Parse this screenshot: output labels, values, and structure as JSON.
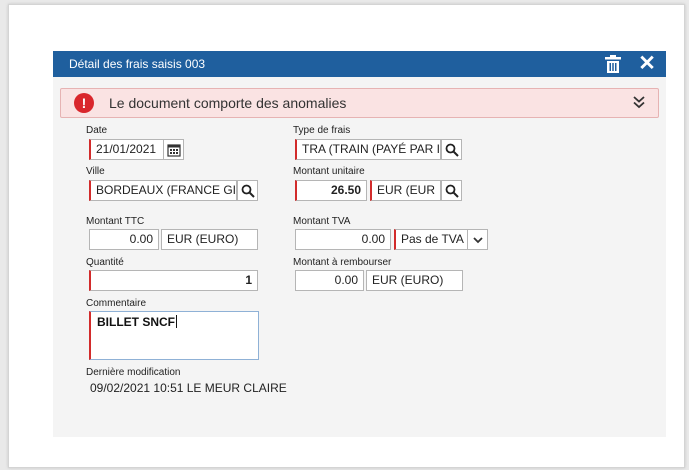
{
  "window": {
    "title": "Détail des frais saisis 003"
  },
  "alert": {
    "message": "Le document comporte des anomalies"
  },
  "icons": {
    "delete": "trash-icon",
    "close": "close-icon",
    "alert": "exclamation-icon",
    "expand": "double-chevron-down-icon",
    "calendar": "calendar-icon",
    "search": "search-icon",
    "dropdown": "chevron-down-icon"
  },
  "colors": {
    "titlebar": "#1f5f9e",
    "alert_bg": "#fae3e3",
    "alert_icon": "#d9262c",
    "required_marker": "#d22b2b"
  },
  "form": {
    "date": {
      "label": "Date",
      "value": "21/01/2021"
    },
    "type_frais": {
      "label": "Type de frais",
      "value": "TRA (TRAIN (PAYÉ PAR I"
    },
    "ville": {
      "label": "Ville",
      "value": "BORDEAUX (FRANCE GI"
    },
    "montant_unitaire": {
      "label": "Montant unitaire",
      "value": "26.50",
      "currency": "EUR (EUR"
    },
    "montant_ttc": {
      "label": "Montant TTC",
      "value": "0.00",
      "currency": "EUR (EURO)"
    },
    "montant_tva": {
      "label": "Montant TVA",
      "value": "0.00",
      "tva_type": "Pas de TVA"
    },
    "quantite": {
      "label": "Quantité",
      "value": "1"
    },
    "montant_rembourser": {
      "label": "Montant à rembourser",
      "value": "0.00",
      "currency": "EUR (EURO)"
    },
    "commentaire": {
      "label": "Commentaire",
      "value": "BILLET SNCF"
    },
    "derniere_modification": {
      "label": "Dernière modification",
      "value": "09/02/2021 10:51 LE MEUR CLAIRE"
    }
  }
}
